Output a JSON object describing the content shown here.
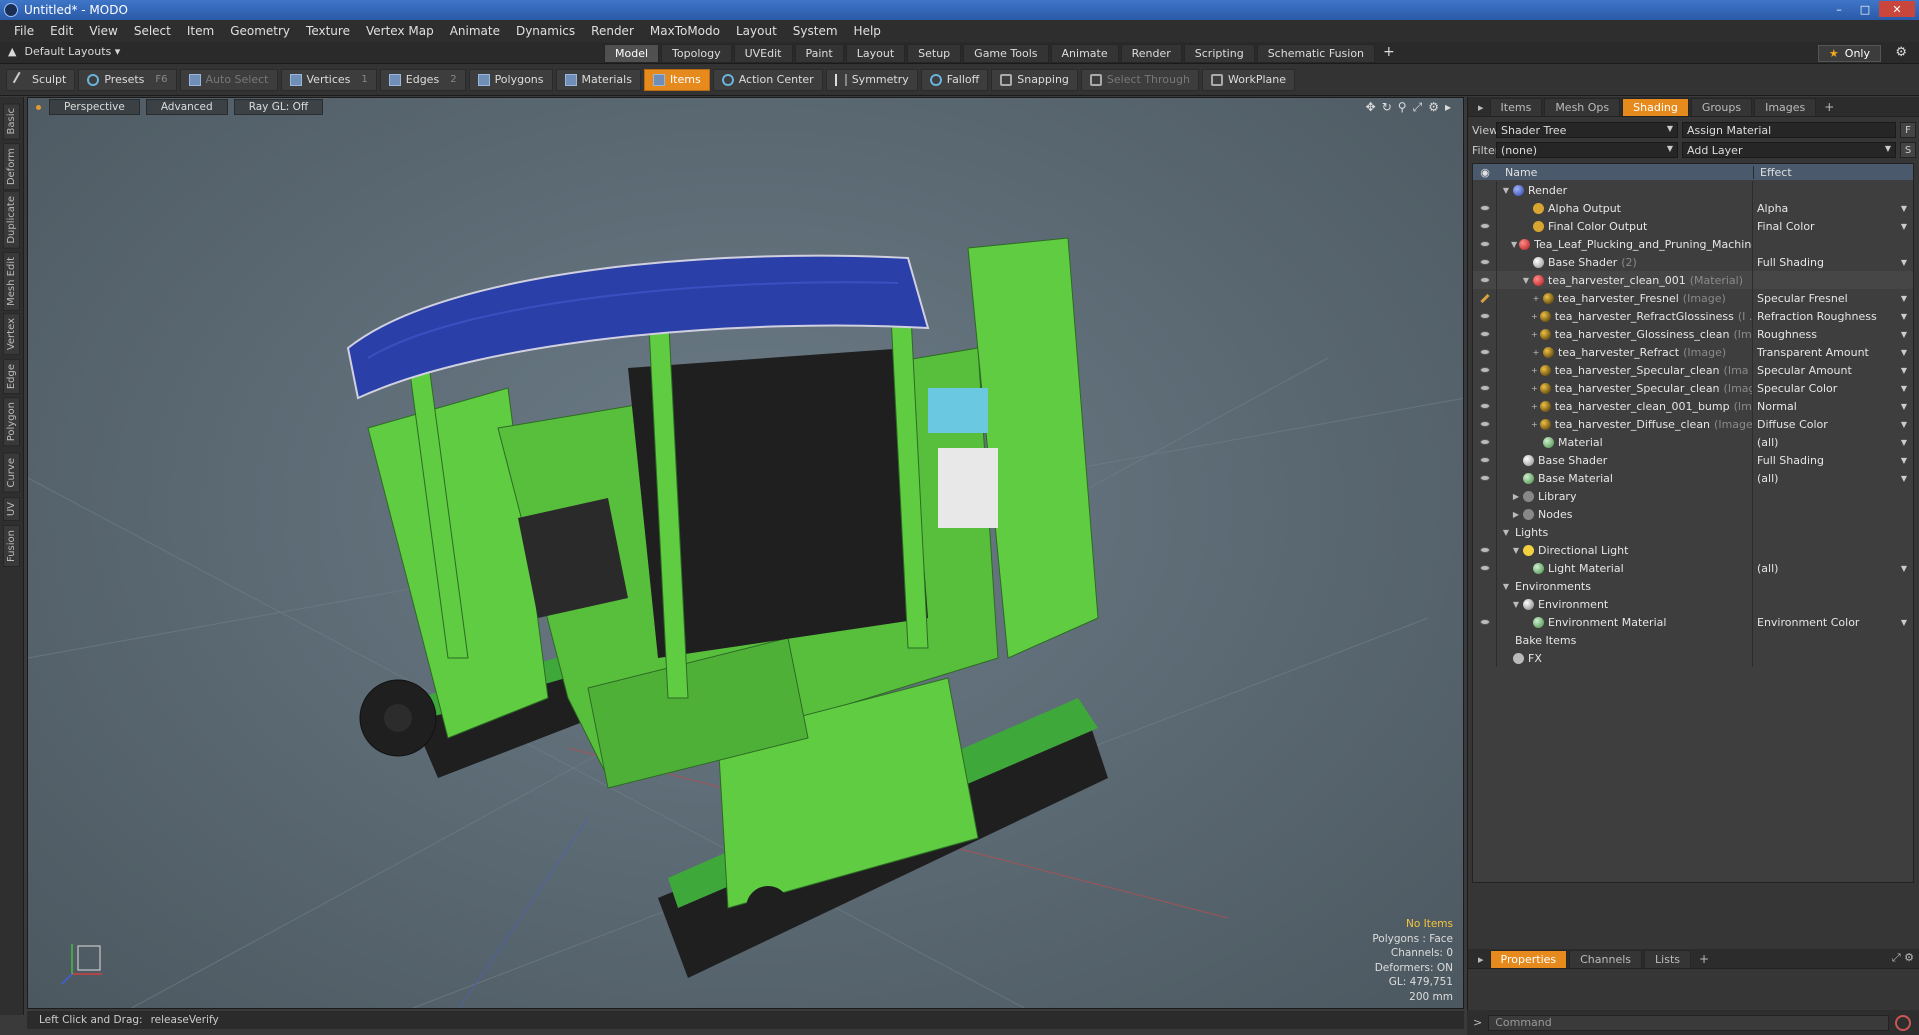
{
  "window": {
    "title": "Untitled* - MODO"
  },
  "menu": [
    "File",
    "Edit",
    "View",
    "Select",
    "Item",
    "Geometry",
    "Texture",
    "Vertex Map",
    "Animate",
    "Dynamics",
    "Render",
    "MaxToModo",
    "Layout",
    "System",
    "Help"
  ],
  "layoutbar": {
    "layouts_label": "Default Layouts",
    "tabs": [
      "Model",
      "Topology",
      "UVEdit",
      "Paint",
      "Layout",
      "Setup",
      "Game Tools",
      "Animate",
      "Render",
      "Scripting",
      "Schematic Fusion"
    ],
    "active_tab": "Model",
    "only_label": "Only"
  },
  "toolbar": {
    "sculpt": "Sculpt",
    "presets": "Presets",
    "presets_key": "F6",
    "auto_select": "Auto Select",
    "vertices": "Vertices",
    "vertices_key": "1",
    "edges": "Edges",
    "edges_key": "2",
    "polygons": "Polygons",
    "materials": "Materials",
    "items": "Items",
    "action_center": "Action Center",
    "symmetry": "Symmetry",
    "falloff": "Falloff",
    "snapping": "Snapping",
    "select_through": "Select Through",
    "workplane": "WorkPlane"
  },
  "left_tabs": [
    "Basic",
    "Deform",
    "Duplicate",
    "Mesh Edit",
    "Vertex",
    "Edge",
    "Polygon",
    "Curve",
    "UV",
    "Fusion"
  ],
  "viewport": {
    "perspective": "Perspective",
    "advanced": "Advanced",
    "raygl": "Ray GL: Off",
    "info": {
      "no_items": "No Items",
      "polygons": "Polygons : Face",
      "channels": "Channels: 0",
      "deformers": "Deformers: ON",
      "gl": "GL: 479,751",
      "scale": "200 mm"
    },
    "colors": {
      "body": "#5fcc42",
      "canopy": "#2a3fa8",
      "dark": "#1f1f1f"
    }
  },
  "statusbar": {
    "hint": "Left Click and Drag:",
    "action": "releaseVerify"
  },
  "panel": {
    "tabs": [
      "Items",
      "Mesh Ops",
      "Shading",
      "Groups",
      "Images"
    ],
    "active_tab": "Shading",
    "view_label": "View",
    "view_value": "Shader Tree",
    "assign_material": "Assign Material",
    "f_btn": "F",
    "filter_label": "Filter",
    "filter_value": "(none)",
    "add_layer": "Add Layer",
    "s_btn": "S",
    "col_name": "Name",
    "col_effect": "Effect",
    "rows": [
      {
        "name": "Render",
        "icon": "render",
        "indent": 0,
        "exp": "▼",
        "eye": "none",
        "effect": "",
        "sub": ""
      },
      {
        "name": "Alpha Output",
        "icon": "output",
        "indent": 2,
        "exp": "",
        "eye": "eye",
        "effect": "Alpha",
        "sub": ""
      },
      {
        "name": "Final Color Output",
        "icon": "output",
        "indent": 2,
        "exp": "",
        "eye": "eye",
        "effect": "Final Color",
        "sub": ""
      },
      {
        "name": "Tea_Leaf_Plucking_and_Pruning_Machine ...",
        "icon": "group",
        "indent": 1,
        "exp": "▼",
        "eye": "eye",
        "effect": "",
        "sub": ""
      },
      {
        "name": "Base Shader",
        "icon": "shader",
        "indent": 2,
        "exp": "",
        "eye": "eye",
        "effect": "Full Shading",
        "sub": "(2)"
      },
      {
        "name": "tea_harvester_clean_001",
        "icon": "group",
        "indent": 2,
        "exp": "▼",
        "eye": "eye",
        "effect": "",
        "sub": "(Material)"
      },
      {
        "name": "tea_harvester_Fresnel",
        "icon": "image",
        "indent": 3,
        "exp": "+",
        "eye": "brush",
        "effect": "Specular Fresnel",
        "sub": "(Image)"
      },
      {
        "name": "tea_harvester_RefractGlossiness",
        "icon": "image",
        "indent": 3,
        "exp": "+",
        "eye": "eye",
        "effect": "Refraction Roughness",
        "sub": "(I ..."
      },
      {
        "name": "tea_harvester_Glossiness_clean",
        "icon": "image",
        "indent": 3,
        "exp": "+",
        "eye": "eye",
        "effect": "Roughness",
        "sub": "(Im ..."
      },
      {
        "name": "tea_harvester_Refract",
        "icon": "image",
        "indent": 3,
        "exp": "+",
        "eye": "eye",
        "effect": "Transparent Amount",
        "sub": "(Image)"
      },
      {
        "name": "tea_harvester_Specular_clean",
        "icon": "image",
        "indent": 3,
        "exp": "+",
        "eye": "eye",
        "effect": "Specular Amount",
        "sub": "(Ima ..."
      },
      {
        "name": "tea_harvester_Specular_clean",
        "icon": "image",
        "indent": 3,
        "exp": "+",
        "eye": "eye",
        "effect": "Specular Color",
        "sub": "(Image)"
      },
      {
        "name": "tea_harvester_clean_001_bump",
        "icon": "image",
        "indent": 3,
        "exp": "+",
        "eye": "eye",
        "effect": "Normal",
        "sub": "(Im ..."
      },
      {
        "name": "tea_harvester_Diffuse_clean",
        "icon": "image",
        "indent": 3,
        "exp": "+",
        "eye": "eye",
        "effect": "Diffuse Color",
        "sub": "(Image)"
      },
      {
        "name": "Material",
        "icon": "material",
        "indent": 3,
        "exp": "",
        "eye": "eye",
        "effect": "(all)",
        "sub": ""
      },
      {
        "name": "Base Shader",
        "icon": "shader",
        "indent": 1,
        "exp": "",
        "eye": "eye",
        "effect": "Full Shading",
        "sub": ""
      },
      {
        "name": "Base Material",
        "icon": "material",
        "indent": 1,
        "exp": "",
        "eye": "eye",
        "effect": "(all)",
        "sub": ""
      },
      {
        "name": "Library",
        "icon": "folder",
        "indent": 1,
        "exp": "▶",
        "eye": "none",
        "effect": "",
        "sub": ""
      },
      {
        "name": "Nodes",
        "icon": "folder",
        "indent": 1,
        "exp": "▶",
        "eye": "none",
        "effect": "",
        "sub": ""
      },
      {
        "name": "Lights",
        "icon": "",
        "indent": 0,
        "exp": "▼",
        "eye": "none",
        "effect": "",
        "sub": ""
      },
      {
        "name": "Directional Light",
        "icon": "light",
        "indent": 1,
        "exp": "▼",
        "eye": "eye",
        "effect": "",
        "sub": ""
      },
      {
        "name": "Light Material",
        "icon": "material",
        "indent": 2,
        "exp": "",
        "eye": "eye",
        "effect": "(all)",
        "sub": ""
      },
      {
        "name": "Environments",
        "icon": "",
        "indent": 0,
        "exp": "▼",
        "eye": "none",
        "effect": "",
        "sub": ""
      },
      {
        "name": "Environment",
        "icon": "env",
        "indent": 1,
        "exp": "▼",
        "eye": "none",
        "effect": "",
        "sub": ""
      },
      {
        "name": "Environment Material",
        "icon": "material",
        "indent": 2,
        "exp": "",
        "eye": "eye",
        "effect": "Environment Color",
        "sub": ""
      },
      {
        "name": "Bake Items",
        "icon": "",
        "indent": 0,
        "exp": "",
        "eye": "none",
        "effect": "",
        "sub": ""
      },
      {
        "name": "FX",
        "icon": "fx",
        "indent": 0,
        "exp": "",
        "eye": "none",
        "effect": "",
        "sub": ""
      }
    ],
    "bottom_tabs": [
      "Properties",
      "Channels",
      "Lists"
    ],
    "bottom_active": "Properties",
    "command_placeholder": "Command"
  }
}
